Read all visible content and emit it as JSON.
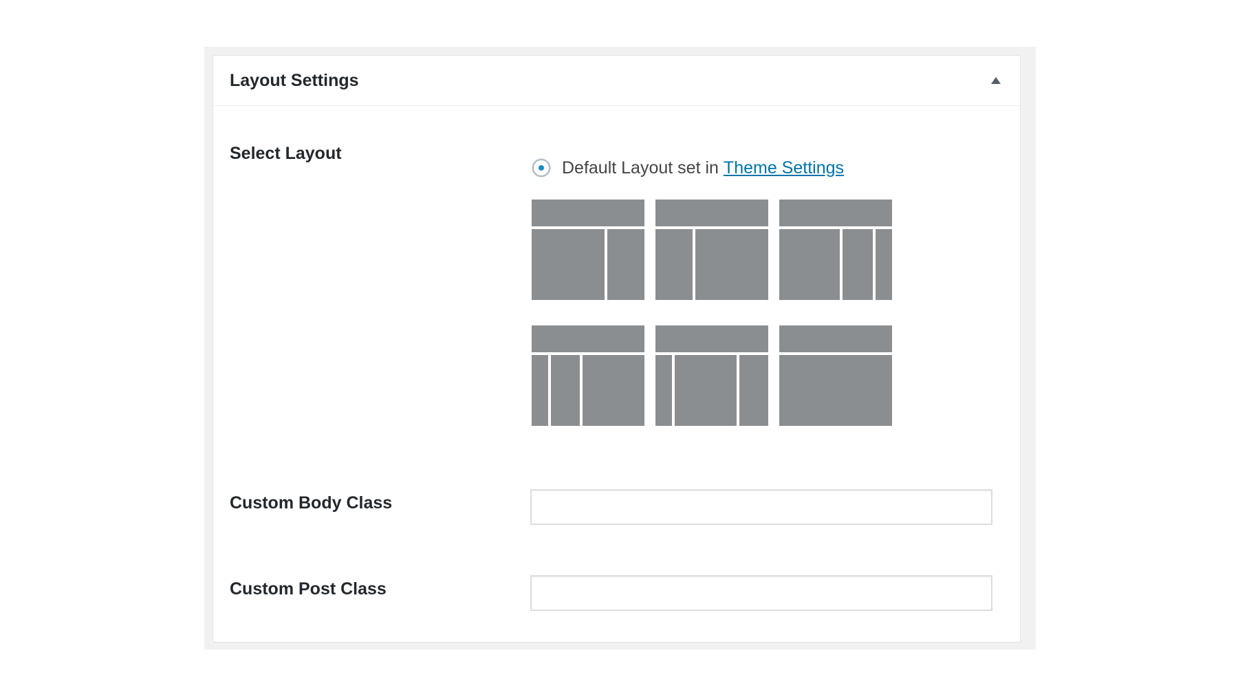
{
  "metabox": {
    "title": "Layout Settings",
    "toggle_icon": "triangle-up-icon"
  },
  "select_layout": {
    "label": "Select Layout",
    "default_option": {
      "text": "Default Layout set in",
      "link_text": "Theme Settings",
      "selected": true
    },
    "layouts": [
      {
        "name": "content-sidebar"
      },
      {
        "name": "sidebar-content"
      },
      {
        "name": "content-sidebar-sidebar"
      },
      {
        "name": "sidebar-sidebar-content"
      },
      {
        "name": "sidebar-content-sidebar"
      },
      {
        "name": "full-width-content"
      }
    ]
  },
  "custom_body_class": {
    "label": "Custom Body Class",
    "value": ""
  },
  "custom_post_class": {
    "label": "Custom Post Class",
    "value": ""
  },
  "colors": {
    "layout_block": "#8b8e90",
    "link": "#0073aa",
    "radio_dot": "#1e8cbe"
  }
}
